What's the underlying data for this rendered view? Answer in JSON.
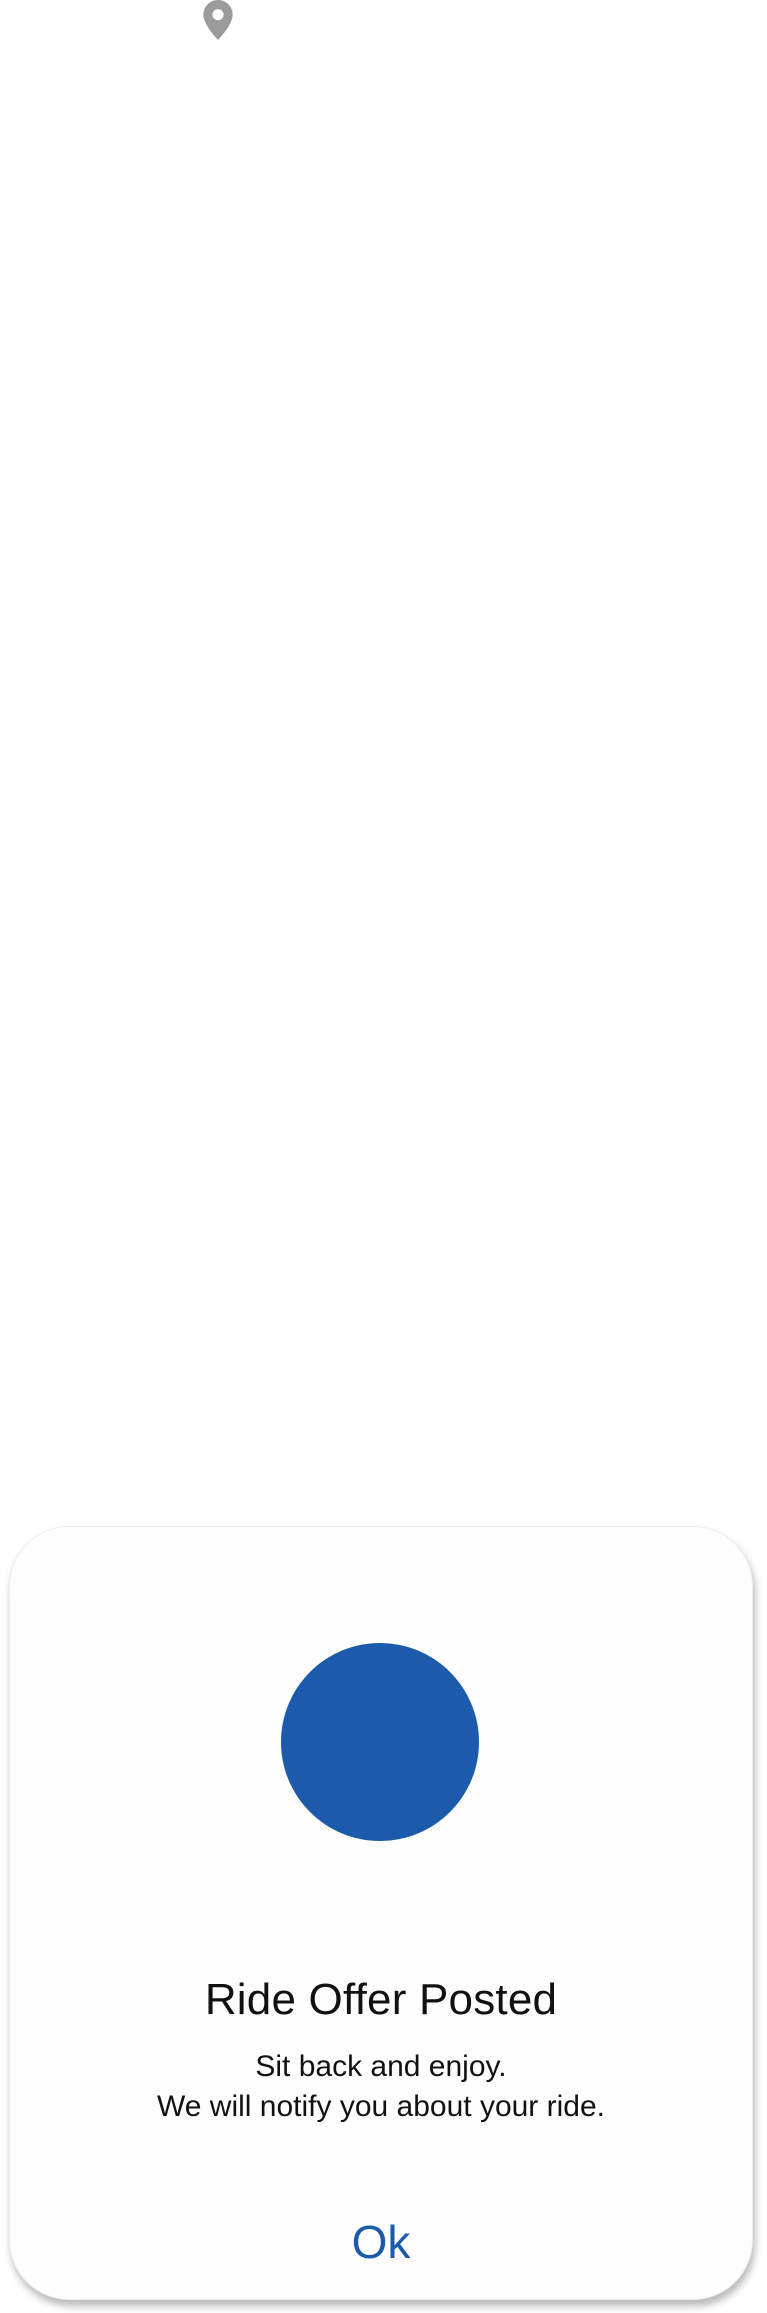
{
  "map": {
    "pin_icon": "map-pin-icon",
    "pin_color": "#9b9b9b"
  },
  "dialog": {
    "icon": "status-circle",
    "accent_color": "#1c5bab",
    "title": "Ride Offer Posted",
    "message_line1": "Sit back and enjoy.",
    "message_line2": "We will notify you about your ride.",
    "ok_label": "Ok"
  }
}
